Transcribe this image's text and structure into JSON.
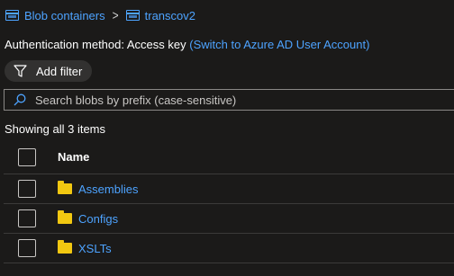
{
  "breadcrumb": {
    "items": [
      {
        "label": "Blob containers",
        "icon": "container-icon"
      },
      {
        "label": "transcov2",
        "icon": "container-icon"
      }
    ],
    "separator": ">"
  },
  "auth": {
    "label": "Authentication method:",
    "value": "Access key",
    "switch_link": "(Switch to Azure AD User Account)"
  },
  "filter": {
    "label": "Add filter",
    "icon": "funnel-icon"
  },
  "search": {
    "placeholder": "Search blobs by prefix (case-sensitive)",
    "value": "",
    "icon": "search-icon"
  },
  "status": {
    "count_text": "Showing all 3 items"
  },
  "table": {
    "headers": {
      "name": "Name"
    },
    "rows": [
      {
        "name": "Assemblies",
        "icon": "folder-icon"
      },
      {
        "name": "Configs",
        "icon": "folder-icon"
      },
      {
        "name": "XSLTs",
        "icon": "folder-icon"
      }
    ]
  },
  "colors": {
    "background": "#1b1a19",
    "link": "#4da3ff",
    "folder": "#f2c811"
  }
}
